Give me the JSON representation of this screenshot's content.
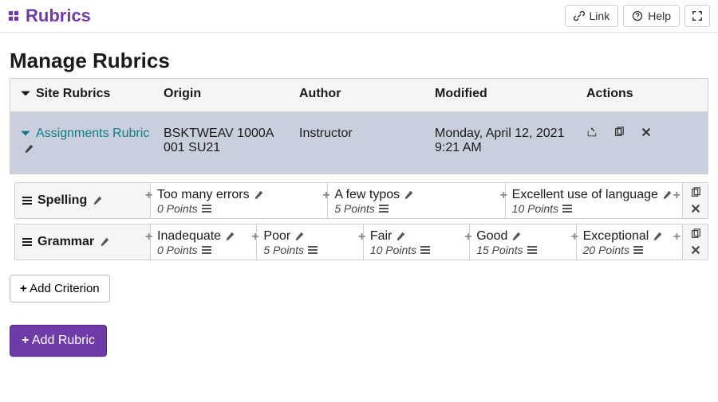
{
  "topbar": {
    "title": "Rubrics",
    "link_label": "Link",
    "help_label": "Help"
  },
  "page_heading": "Manage Rubrics",
  "columns": {
    "site_rubrics": "Site Rubrics",
    "origin": "Origin",
    "author": "Author",
    "modified": "Modified",
    "actions": "Actions"
  },
  "rubric_row": {
    "name": "Assignments Rubric",
    "origin": "BSKTWEAV 1000A 001 SU21",
    "author": "Instructor",
    "modified": "Monday, April 12, 2021 9:21 AM"
  },
  "criteria": [
    {
      "name": "Spelling",
      "levels": [
        {
          "title": "Too many errors",
          "points": "0 Points"
        },
        {
          "title": "A few typos",
          "points": "5 Points"
        },
        {
          "title": "Excellent use of language",
          "points": "10 Points"
        }
      ]
    },
    {
      "name": "Grammar",
      "levels": [
        {
          "title": "Inadequate",
          "points": "0 Points"
        },
        {
          "title": "Poor",
          "points": "5 Points"
        },
        {
          "title": "Fair",
          "points": "10 Points"
        },
        {
          "title": "Good",
          "points": "15 Points"
        },
        {
          "title": "Exceptional",
          "points": "20 Points"
        }
      ]
    }
  ],
  "buttons": {
    "add_criterion": "Add Criterion",
    "add_rubric": "Add Rubric"
  }
}
